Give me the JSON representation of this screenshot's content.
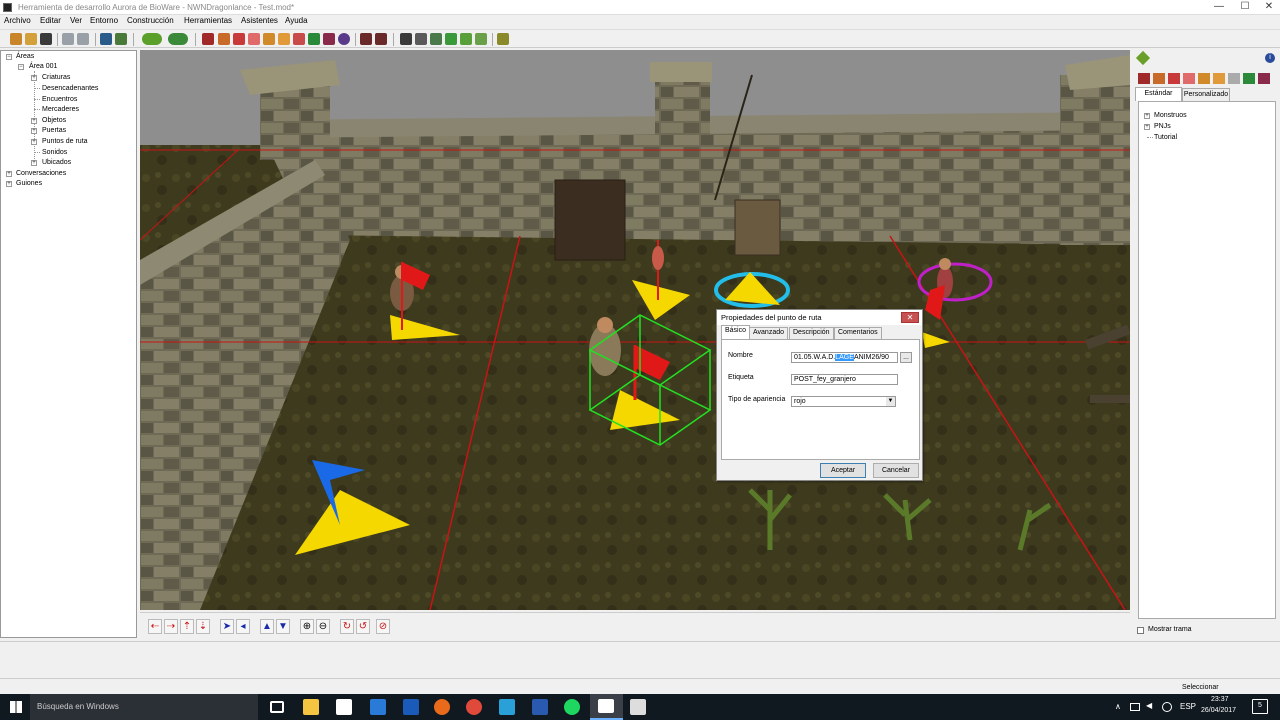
{
  "window": {
    "title": "Herramienta de desarrollo Aurora de BioWare - NWNDragonlance - Test.mod*",
    "minimize": "—",
    "maximize": "☐",
    "close": "✕"
  },
  "menu": [
    "Archivo",
    "Editar",
    "Ver",
    "Entorno",
    "Construcción",
    "Herramientas",
    "Asistentes",
    "Ayuda"
  ],
  "tree": {
    "root": "Áreas",
    "area": "Área 001",
    "items": [
      "Criaturas",
      "Desencadenantes",
      "Encuentros",
      "Mercaderes",
      "Objetos",
      "Puertas",
      "Puntos de ruta",
      "Sonidos",
      "Ubicados"
    ],
    "conversations": "Conversaciones",
    "scripts": "Guiones"
  },
  "palette": {
    "tabs": [
      "Estándar",
      "Personalizado"
    ],
    "items": [
      "Monstruos",
      "PNJs",
      "Tutorial"
    ],
    "show_trail_label": "Mostrar trama"
  },
  "dialog": {
    "title": "Propiedades del punto de ruta",
    "tabs": [
      "Básico",
      "Avanzado",
      "Descripción",
      "Comentarios"
    ],
    "name_label": "Nombre",
    "name_prefix": "01.05.W.A.D.",
    "name_selected": "LAGE",
    "name_suffix": "ANIM26/90",
    "name_browse": "...",
    "tag_label": "Etiqueta",
    "tag_value": "POST_fey_granjero",
    "appearance_label": "Tipo de apariencia",
    "appearance_value": "rojo",
    "accept": "Aceptar",
    "cancel": "Cancelar"
  },
  "status": {
    "selection": "Seleccionar"
  },
  "taskbar": {
    "search_placeholder": "Búsqueda en Windows",
    "language": "ESP",
    "time": "23:37",
    "date": "26/04/2017",
    "notifications": "5"
  },
  "colors": {
    "waypoint_yellow": "#f5d800",
    "flag_red": "#e01818",
    "flag_blue": "#1a6ae8",
    "grid_red": "#c81414",
    "selection_green": "#22e022",
    "ring_cyan": "#22bde8",
    "ring_magenta": "#c020c8"
  }
}
